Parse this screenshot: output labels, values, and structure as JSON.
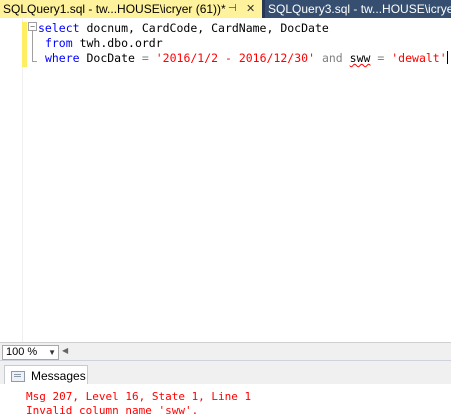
{
  "tabs": [
    {
      "label": "SQLQuery1.sql - tw...HOUSE\\icryer (61))*",
      "active": true,
      "pin_icon": "pin-icon",
      "close_icon": "close-icon"
    },
    {
      "label": "SQLQuery3.sql - tw...HOUSE\\icryer",
      "active": false
    }
  ],
  "editor": {
    "line1": {
      "kw": "select",
      "rest": " docnum, CardCode, CardName, DocDate"
    },
    "line2": {
      "kw": "from",
      "rest": " twh.dbo.ordr"
    },
    "line3": {
      "kw_where": "where",
      "col": " DocDate ",
      "eq1": "=",
      "str1": "'2016/1/2 - 2016/12/30'",
      "and": "and",
      "sww": "sww",
      "eq2": "=",
      "str2": "'dewalt'"
    },
    "collapse_glyph": "−"
  },
  "status": {
    "zoom": "100 %"
  },
  "results": {
    "tab_label": "Messages",
    "messages": [
      "Msg 207, Level 16, State 1, Line 1",
      "Invalid column name 'sww'."
    ]
  },
  "colors": {
    "keyword": "#0000ff",
    "string": "#ff0000",
    "error": "#ff0000",
    "active_tab": "#fff29d",
    "tab_strip": "#293955"
  }
}
